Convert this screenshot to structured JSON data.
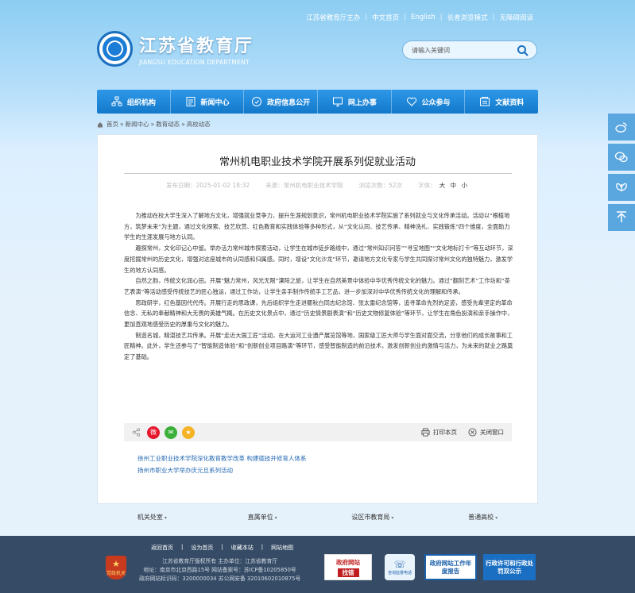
{
  "topbar": {
    "host": "江苏省教育厅主办",
    "home": "中文首页",
    "english": "English",
    "elder": "长者浏览模式",
    "accessible": "无障碍阅读"
  },
  "logo": {
    "cn": "江苏省教育厅",
    "en": "JIANGSU EDUCATION DEPARTMENT"
  },
  "search": {
    "placeholder": "请输入关键词"
  },
  "nav": [
    {
      "label": "组织机构",
      "icon": "org-icon"
    },
    {
      "label": "新闻中心",
      "icon": "news-icon"
    },
    {
      "label": "政府信息公开",
      "icon": "info-icon"
    },
    {
      "label": "网上办事",
      "icon": "online-icon"
    },
    {
      "label": "公众参与",
      "icon": "heart-icon"
    },
    {
      "label": "文献资料",
      "icon": "docs-icon"
    }
  ],
  "breadcrumb": [
    "首页",
    "新闻中心",
    "教育动态",
    "高校动态"
  ],
  "article": {
    "title": "常州机电职业技术学院开展系列促就业活动",
    "date": "发布日期：2025-01-02 18:32",
    "source": "来源：常州机电职业技术学院",
    "views": "浏览次数：52次",
    "fontsize_label": "字体：",
    "sizes": "大 中 小",
    "paragraphs": [
      "为推动在校大学生深入了解地方文化，增强就业竞争力，提升生涯规划意识，常州机电职业技术学院实施了系列就业与文化传承活动。活动以“根植地方，筑梦未来”为主题，通过文化探索、技艺欣赏、红色教育和实践体验等多种形式，从“文化认同、技艺传承、精神洗礼、实践锻炼”四个维度，全面助力学生的生涯发展与地方认同。",
      "趣探常州，文化印记心中留。举办活力常州城市探索活动，让学生在城市徒步路线中，通过“常州知识问答”“寻宝地图”“文化地标打卡”等互动环节，深度挖掘常州的历史文化，增强对这座城市的认同感和归属感。同时，增设“文化沙龙”环节，邀请地方文化专家与学生共同探讨常州文化的独特魅力，激发学生的地方认同感。",
      "自然之韵，传统文化润心田。开展“魅力常州，风光无限”溧阳之旅，让学生在自然美景中体验中华优秀传统文化的魅力。通过“翻刻艺术”工作坊和“茶艺表演”等活动感受传统技艺的匠心独运，通过工作坊，让学生亲手制作传统手工艺品，进一步加深对中华优秀传统文化的理解和传承。",
      "思政研学，红色基因代代传。开展行走的思政课，先后组织学生走进瞿秋白同志纪念馆、张太雷纪念馆等，追寻革命先烈的足迹，感受先辈坚定的革命信念、无私的奉献精神和大无畏的英雄气概。在历史文化景点中，通过“历史情景剧表演”和“历史文物修复体验”等环节，让学生在角色扮演和亲手操作中，更加直观地感受历史的厚重与文化的魅力。",
      "制造名城，精湛技艺共传承。开展“走近大国工匠”活动，在大运河工业遗产展览馆等地，国家级工匠大师与学生面对面交流，分享他们的成长故事和工匠精神。此外，学生还参与了“智能制造体验”和“创新创业项目路演”等环节，感受智能制造的前沿技术，激发创新创业的激情与活力，为未来的就业之路奠定了基础。"
    ]
  },
  "share": {
    "print": "打印本页",
    "close": "关闭窗口"
  },
  "related": [
    "徐州工业职业技术学院深化教育教学改革 构建德技并修育人体系",
    "扬州市职业大学举办庆元旦系列活动"
  ],
  "bottom_links": [
    "机关处室",
    "直属单位",
    "设区市教育局",
    "普通高校"
  ],
  "footer": {
    "links": [
      "返回首页",
      "设为首页",
      "收藏本站",
      "网站地图"
    ],
    "line1": "江苏省教育厅版权所有 主办单位：江苏省教育厅",
    "line2": "地址：南京市北京西路15号 网站备案号：苏ICP备10205850号",
    "line3": "政府网站标识码：3200000034   苏公网安备 32010602010875号",
    "party_badge": "党政机关",
    "gov_site": "政府网站",
    "gov_site_sub": "找错",
    "phone": "咨询监督电话",
    "annual": "政府网站工作年度报告",
    "license": "行政许可和行政处罚双公示"
  },
  "colors": {
    "nav": "#1a85d6",
    "footer": "#364c66",
    "link": "#2469b3"
  }
}
